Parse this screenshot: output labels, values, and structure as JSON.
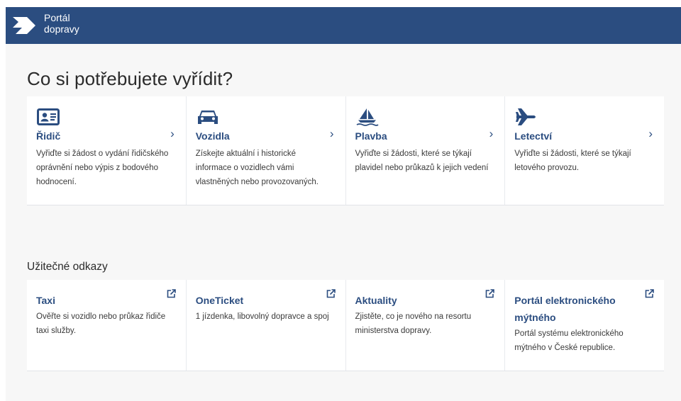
{
  "header": {
    "logo_line1": "Portál",
    "logo_line2": "dopravy"
  },
  "main": {
    "title": "Co si potřebujete vyřídit?",
    "services": [
      {
        "icon": "id-card-icon",
        "title": "Řidič",
        "desc": "Vyřiďte si žádost o vydání řidičského oprávnění nebo výpis z bodového hodnocení."
      },
      {
        "icon": "car-icon",
        "title": "Vozidla",
        "desc": "Získejte aktuální i historické informace o vozidlech vámi vlastněných nebo provozovaných."
      },
      {
        "icon": "sailboat-icon",
        "title": "Plavba",
        "desc": "Vyřiďte si žádosti, které se týkají plavidel nebo průkazů k jejich vedení"
      },
      {
        "icon": "airplane-icon",
        "title": "Letectví",
        "desc": "Vyřiďte si žádosti, které se týkají letového provozu."
      }
    ],
    "chevron": "›"
  },
  "links_section": {
    "heading": "Užitečné odkazy",
    "links": [
      {
        "title": "Taxi",
        "desc": "Ověřte si vozidlo nebo průkaz řidiče taxi služby."
      },
      {
        "title": "OneTicket",
        "desc": "1 jízdenka, libovolný dopravce a spoj"
      },
      {
        "title": "Aktuality",
        "desc": "Zjistěte, co je nového na resortu ministerstva dopravy."
      },
      {
        "title": "Portál elektronického mýtného",
        "desc": "Portál systému elektronického mýtného v České republice."
      }
    ]
  },
  "colors": {
    "brand": "#2b4d80",
    "background": "#f7f7f7",
    "card": "#ffffff"
  }
}
